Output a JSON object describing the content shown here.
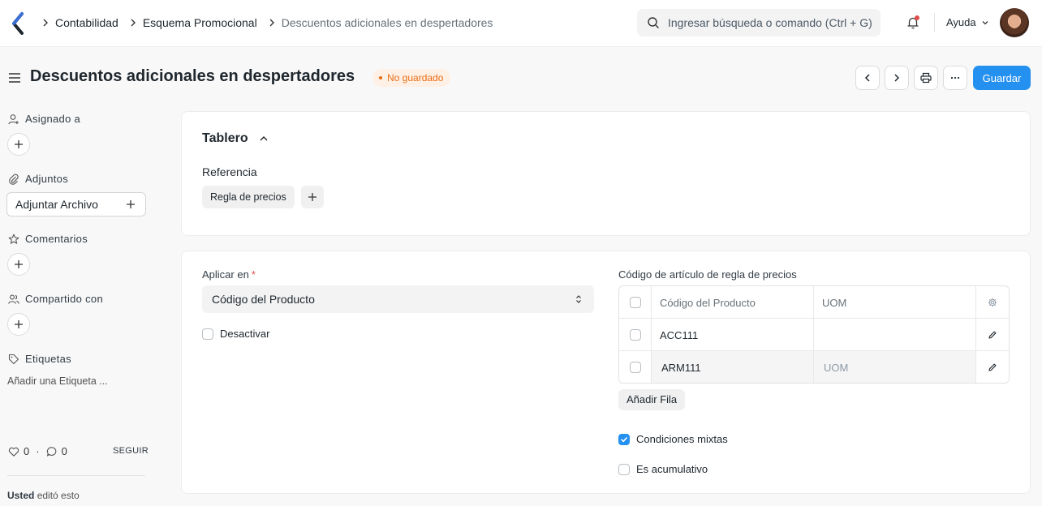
{
  "navbar": {
    "breadcrumbs": [
      "Contabilidad",
      "Esquema Promocional",
      "Descuentos adicionales en despertadores"
    ],
    "search_placeholder": "Ingresar búsqueda o comando (Ctrl + G)",
    "help_label": "Ayuda"
  },
  "page": {
    "title": "Descuentos adicionales en despertadores",
    "status": "No guardado",
    "save_label": "Guardar"
  },
  "sidebar": {
    "assigned_label": "Asignado a",
    "attachments_label": "Adjuntos",
    "attach_button": "Adjuntar Archivo",
    "comments_label": "Comentarios",
    "shared_label": "Compartido con",
    "tags_label": "Etiquetas",
    "add_tag": "Añadir una Etiqueta ...",
    "likes_count": "0",
    "comments_count": "0",
    "follow_label": "SEGUIR",
    "edited_by": "Usted",
    "edited_text": "editó esto"
  },
  "dashboard": {
    "title": "Tablero",
    "reference_label": "Referencia",
    "reference_pill": "Regla de precios"
  },
  "form": {
    "apply_on_label": "Aplicar en",
    "apply_on_value": "Código del Producto",
    "disable_label": "Desactivar",
    "disable_checked": false,
    "grid_label": "Código de artículo de regla de precios",
    "grid_columns": [
      "Código del Producto",
      "UOM"
    ],
    "grid_rows": [
      {
        "item_code": "ACC111",
        "uom": ""
      },
      {
        "item_code": "ARM111",
        "uom": "UOM"
      }
    ],
    "add_row_label": "Añadir Fila",
    "mixed_conditions_label": "Condiciones mixtas",
    "mixed_conditions_checked": true,
    "cumulative_label": "Es acumulativo",
    "cumulative_checked": false
  },
  "colors": {
    "primary": "#2490ef",
    "status_orange": "#e86c13"
  }
}
